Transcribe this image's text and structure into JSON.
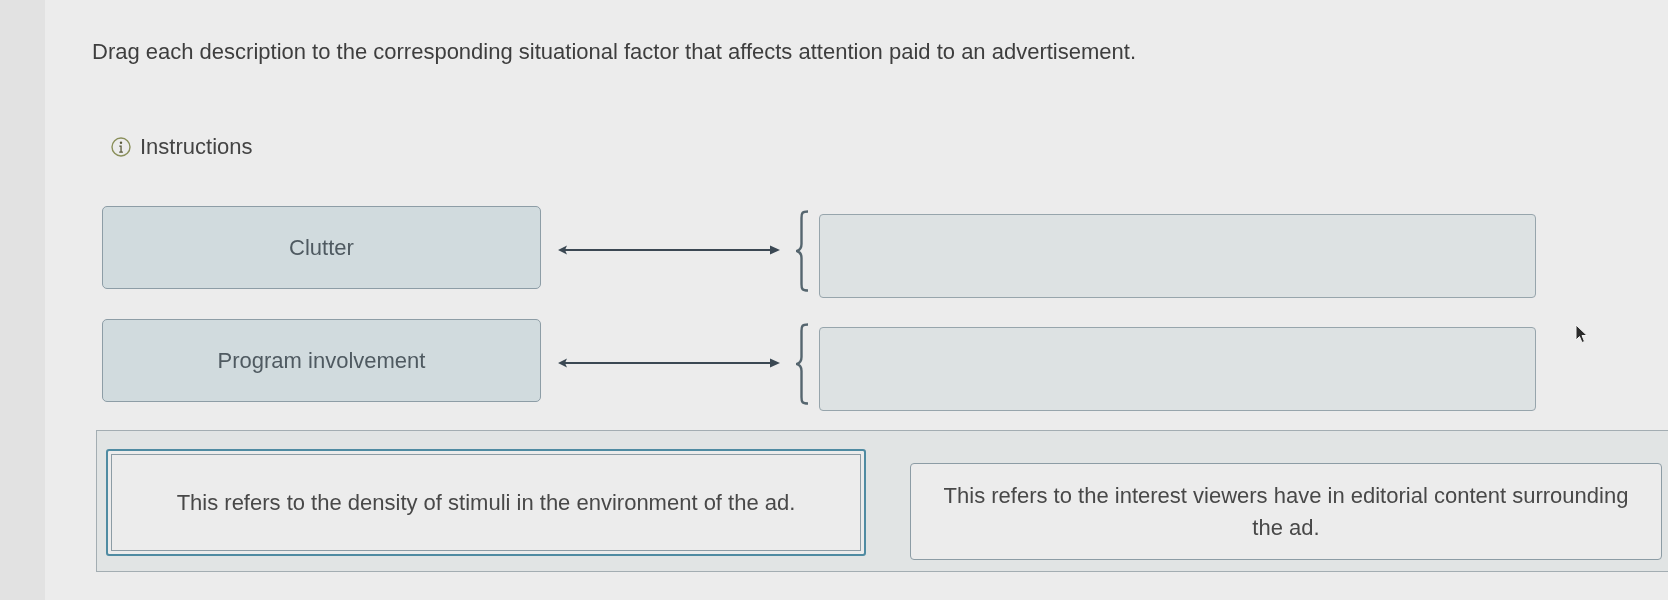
{
  "prompt": "Drag each description to the corresponding situational factor that affects attention paid to an advertisement.",
  "instructions": {
    "label": "Instructions"
  },
  "pairs": [
    {
      "factor": "Clutter"
    },
    {
      "factor": "Program involvement"
    }
  ],
  "descriptions": [
    {
      "text": "This refers to the density of stimuli in the environment of the ad.",
      "selected": true
    },
    {
      "text": "This refers to the interest viewers have in editorial content surrounding the ad.",
      "selected": false
    }
  ]
}
